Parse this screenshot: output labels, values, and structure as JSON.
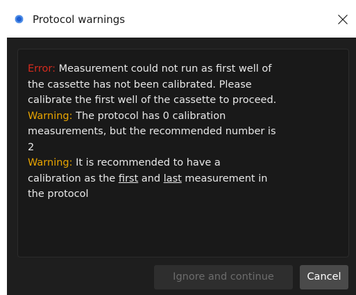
{
  "window": {
    "title": "Protocol warnings",
    "icon": "app-logo-icon",
    "close_icon": "close-icon"
  },
  "messages": {
    "error_label": "Error:",
    "error_line1": " Measurement could not run as first well of",
    "error_line2": "the cassette has not been calibrated. Please",
    "error_line3": "calibrate the first well of the cassette to proceed.",
    "warning1_label": "Warning:",
    "warning1_line1": " The protocol has 0 calibration",
    "warning1_line2": "measurements, but the recommended number is",
    "warning1_line3": "2",
    "warning2_label": "Warning:",
    "warning2_line1": " It is recommended to have a",
    "warning2_line2_a": "calibration as the ",
    "warning2_line2_first": "first",
    "warning2_line2_b": " and ",
    "warning2_line2_last": "last",
    "warning2_line2_c": " measurement in",
    "warning2_line3": "the protocol"
  },
  "buttons": {
    "ignore_label": "Ignore and continue",
    "cancel_label": "Cancel"
  },
  "colors": {
    "error": "#d42b1e",
    "warning": "#e8a400",
    "text": "#e8e8e8",
    "background": "#1e1e1e"
  }
}
